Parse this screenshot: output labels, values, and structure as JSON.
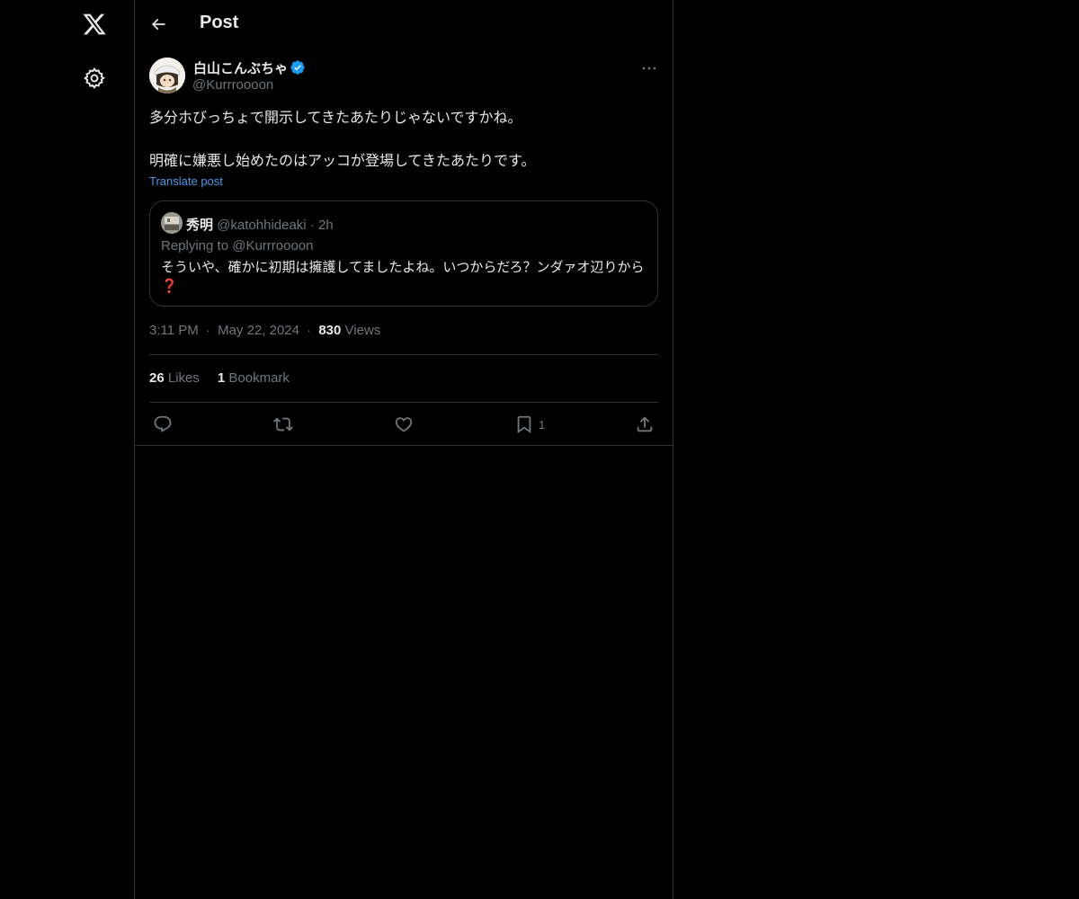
{
  "nav": {
    "logo_icon": "x-logo-icon",
    "settings_icon": "gear-icon"
  },
  "header": {
    "title": "Post",
    "back_icon": "arrow-left-icon"
  },
  "post": {
    "author_name": "白山こんぶちゃ",
    "author_handle": "@Kurrroooon",
    "verified_color": "#1d9bf0",
    "body": [
      "多分ホびっちょで開示してきたあたりじゃないですかね。",
      "明確に嫌悪し始めたのはアッコが登場してきたあたりです。"
    ],
    "translate_label": "Translate post",
    "quote": {
      "author_name": "秀明",
      "author_handle": "@katohhideaki",
      "dot": "·",
      "time": "2h",
      "replying_to": "Replying to @Kurrroooon",
      "text": "そういや、確かに初期は擁護してましたよね。いつからだろ？ンダァオ辺りから",
      "emoji": "❓"
    },
    "time": "3:11 PM",
    "date": "May 22, 2024",
    "meta_sep": "·",
    "views_count": "830",
    "views_label": "Views",
    "likes_count": "26",
    "likes_label": "Likes",
    "bookmarks_count": "1",
    "bookmarks_label": "Bookmark",
    "actions": {
      "reply_icon": "reply-icon",
      "repost_icon": "repost-icon",
      "like_icon": "heart-icon",
      "bookmark_icon": "bookmark-icon",
      "bookmark_count": "1",
      "share_icon": "share-icon"
    },
    "more_icon": "more-dots-icon"
  }
}
